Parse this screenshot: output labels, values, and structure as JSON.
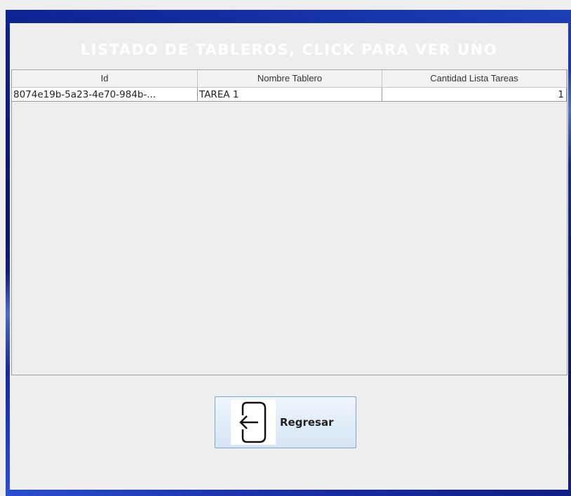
{
  "window": {
    "title": "LISTADO DE TABLEROS, CLICK PARA VER UNO"
  },
  "table": {
    "columns": [
      "Id",
      "Nombre Tablero",
      "Cantidad Lista Tareas"
    ],
    "rows": [
      {
        "id": "8074e19b-5a23-4e70-984b-...",
        "nombre": "TAREA 1",
        "cantidad": "1"
      }
    ]
  },
  "footer": {
    "back_button_label": "Regresar",
    "back_button_icon": "back-arrow-icon"
  }
}
